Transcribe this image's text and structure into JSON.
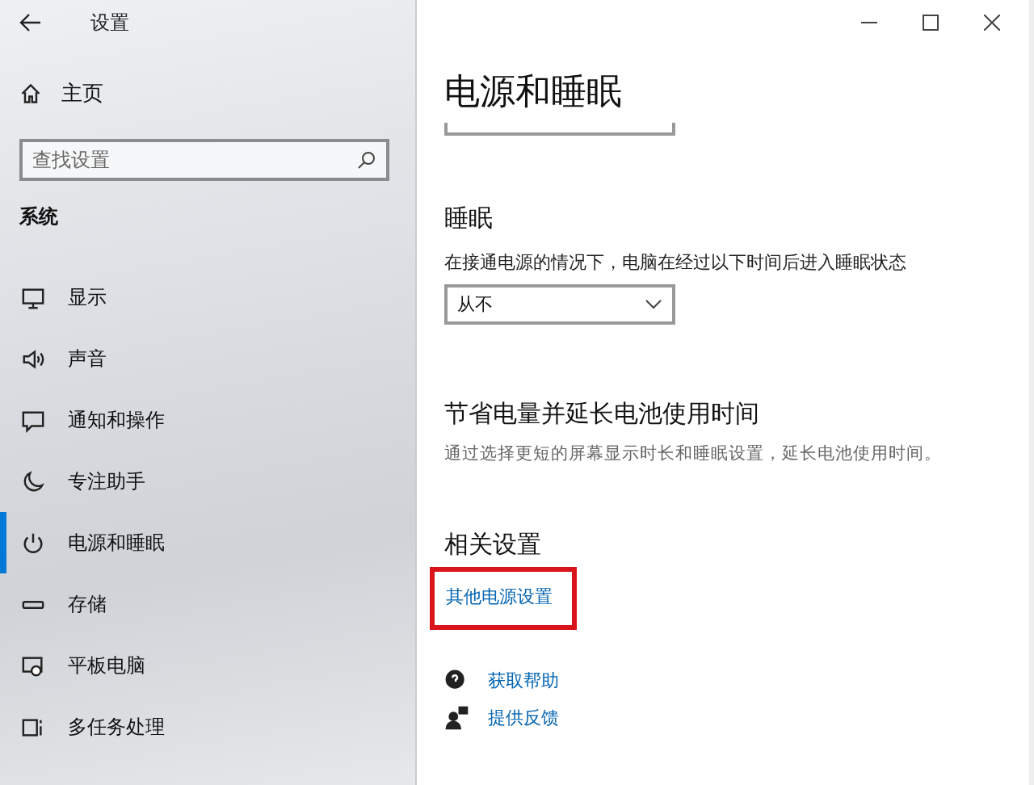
{
  "window": {
    "title": "设置"
  },
  "sidebar": {
    "home": "主页",
    "search": {
      "placeholder": "查找设置"
    },
    "section": "系统",
    "items": [
      {
        "label": "显示",
        "kind": "display",
        "selected": false
      },
      {
        "label": "声音",
        "kind": "sound",
        "selected": false
      },
      {
        "label": "通知和操作",
        "kind": "notification",
        "selected": false
      },
      {
        "label": "专注助手",
        "kind": "moon",
        "selected": false
      },
      {
        "label": "电源和睡眠",
        "kind": "power",
        "selected": true
      },
      {
        "label": "存储",
        "kind": "storage",
        "selected": false
      },
      {
        "label": "平板电脑",
        "kind": "tablet",
        "selected": false
      },
      {
        "label": "多任务处理",
        "kind": "multitask",
        "selected": false
      }
    ]
  },
  "content": {
    "title": "电源和睡眠",
    "sleep": {
      "heading": "睡眠",
      "label": "在接通电源的情况下，电脑在经过以下时间后进入睡眠状态",
      "value": "从不"
    },
    "battery": {
      "heading": "节省电量并延长电池使用时间",
      "description": "通过选择更短的屏幕显示时长和睡眠设置，延长电池使用时间。"
    },
    "related": {
      "heading": "相关设置",
      "link": {
        "label": "其他电源设置",
        "highlighted": true
      }
    },
    "help": [
      {
        "label": "获取帮助",
        "kind": "help"
      },
      {
        "label": "提供反馈",
        "kind": "feedback"
      }
    ]
  }
}
